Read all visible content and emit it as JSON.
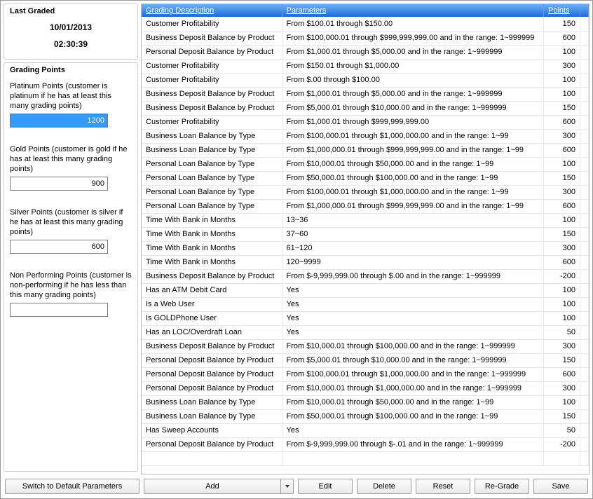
{
  "left": {
    "last_graded": {
      "title": "Last Graded",
      "date": "10/01/2013",
      "time": "02:30:39"
    },
    "grading_points": {
      "title": "Grading Points",
      "platinum": {
        "label": "Platinum Points (customer is platinum if he has at least this many grading points)",
        "value": "1200"
      },
      "gold": {
        "label": "Gold Points (customer is gold if he has at least this many grading points)",
        "value": "900"
      },
      "silver": {
        "label": "Silver Points (customer is silver if he has at least this many grading points)",
        "value": "600"
      },
      "nonperforming": {
        "label": "Non Performing Points (customer is non-performing if he has less than this many grading points)",
        "value": ""
      }
    }
  },
  "table": {
    "headers": {
      "desc": "Grading Description",
      "params": "Parameters",
      "points": "Points"
    },
    "rows": [
      {
        "desc": "Customer Profitability",
        "params": "From $100.01 through $150.00",
        "points": "150"
      },
      {
        "desc": "Business Deposit Balance by Product",
        "params": "From $100,000.01 through $999,999,999.00 and in the range: 1~999999",
        "points": "600"
      },
      {
        "desc": "Personal Deposit Balance by Product",
        "params": "From $1,000.01 through $5,000.00 and in the range: 1~999999",
        "points": "100"
      },
      {
        "desc": "Customer Profitability",
        "params": "From $150.01 through $1,000.00",
        "points": "300"
      },
      {
        "desc": "Customer Profitability",
        "params": "From $.00 through $100.00",
        "points": "100"
      },
      {
        "desc": "Business Deposit Balance by Product",
        "params": "From $1,000.01 through $5,000.00 and in the range: 1~999999",
        "points": "100"
      },
      {
        "desc": "Business Deposit Balance by Product",
        "params": "From $5,000.01 through $10,000.00 and in the range: 1~999999",
        "points": "150"
      },
      {
        "desc": "Customer Profitability",
        "params": "From $1,000.01 through $999,999,999.00",
        "points": "600"
      },
      {
        "desc": "Business Loan Balance by Type",
        "params": "From $100,000.01 through $1,000,000.00 and in the range: 1~99",
        "points": "300"
      },
      {
        "desc": "Business Loan Balance by Type",
        "params": "From $1,000,000.01 through $999,999,999.00 and in the range: 1~99",
        "points": "600"
      },
      {
        "desc": "Personal Loan Balance by Type",
        "params": "From $10,000.01 through $50,000.00 and in the range: 1~99",
        "points": "100"
      },
      {
        "desc": "Personal Loan Balance by Type",
        "params": "From $50,000.01 through $100,000.00 and in the range: 1~99",
        "points": "150"
      },
      {
        "desc": "Personal Loan Balance by Type",
        "params": "From $100,000.01 through $1,000,000.00 and in the range: 1~99",
        "points": "300"
      },
      {
        "desc": "Personal Loan Balance by Type",
        "params": "From $1,000,000.01 through $999,999,999.00 and in the range: 1~99",
        "points": "600"
      },
      {
        "desc": "Time With Bank in Months",
        "params": "13~36",
        "points": "100"
      },
      {
        "desc": "Time With Bank in Months",
        "params": "37~60",
        "points": "150"
      },
      {
        "desc": "Time With Bank in Months",
        "params": "61~120",
        "points": "300"
      },
      {
        "desc": "Time With Bank in Months",
        "params": "120~9999",
        "points": "600"
      },
      {
        "desc": "Business Deposit Balance by Product",
        "params": "From $-9,999,999.00 through $.00 and in the range: 1~999999",
        "points": "-200"
      },
      {
        "desc": "Has an ATM Debit Card",
        "params": "Yes",
        "points": "100"
      },
      {
        "desc": "Is a Web User",
        "params": "Yes",
        "points": "100"
      },
      {
        "desc": "Is GOLDPhone User",
        "params": "Yes",
        "points": "100"
      },
      {
        "desc": "Has an LOC/Overdraft Loan",
        "params": "Yes",
        "points": "50"
      },
      {
        "desc": "Business Deposit Balance by Product",
        "params": "From $10,000.01 through $100,000.00 and in the range: 1~999999",
        "points": "300"
      },
      {
        "desc": "Personal Deposit Balance by Product",
        "params": "From $5,000.01 through $10,000.00 and in the range: 1~999999",
        "points": "150"
      },
      {
        "desc": "Personal Deposit Balance by Product",
        "params": "From $100,000.01 through $1,000,000.00 and in the range: 1~999999",
        "points": "600"
      },
      {
        "desc": "Personal Deposit Balance by Product",
        "params": "From $10,000.01 through $1,000,000.00 and in the range: 1~999999",
        "points": "300"
      },
      {
        "desc": "Business Loan Balance by Type",
        "params": "From $10,000.01 through $50,000.00 and in the range: 1~99",
        "points": "100"
      },
      {
        "desc": "Business Loan Balance by Type",
        "params": "From $50,000.01 through $100,000.00 and in the range: 1~99",
        "points": "150"
      },
      {
        "desc": "Has Sweep Accounts",
        "params": "Yes",
        "points": "50"
      },
      {
        "desc": "Personal Deposit Balance by Product",
        "params": "From $-9,999,999.00 through $-.01 and in the range: 1~999999",
        "points": "-200"
      }
    ]
  },
  "buttons": {
    "switch": "Switch to Default Parameters",
    "add": "Add",
    "edit": "Edit",
    "delete": "Delete",
    "reset": "Reset",
    "regrade": "Re-Grade",
    "save": "Save"
  }
}
